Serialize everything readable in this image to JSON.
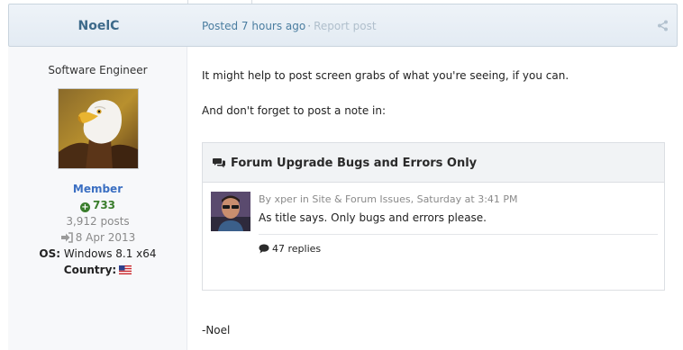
{
  "post": {
    "author": "NoelC",
    "posted": "Posted 7 hours ago",
    "separator": "·",
    "report": "Report post"
  },
  "author_panel": {
    "title": "Software Engineer",
    "group": "Member",
    "reputation": "733",
    "posts": "3,912 posts",
    "joined": "8 Apr 2013",
    "os_label": "OS:",
    "os_value": "Windows 8.1 x64",
    "country_label": "Country:"
  },
  "body": {
    "para1": "It might help to post screen grabs of what you're seeing, if you can.",
    "para2": "And don't forget to post a note in:",
    "signature": "-Noel"
  },
  "embed": {
    "title": "Forum Upgrade Bugs and Errors Only",
    "meta": "By xper in Site & Forum Issues, Saturday at 3:41 PM",
    "text": "As title says. Only bugs and errors please.",
    "replies": "47 replies"
  },
  "icons": {
    "share": "share-icon",
    "reputation": "plus-circle-icon",
    "joined": "sign-in-icon",
    "flag": "us-flag-icon",
    "embed": "comments-icon",
    "replies": "comment-icon"
  },
  "colors": {
    "author": "#3d6a8a",
    "meta_link": "#4a7da0",
    "group": "#3b6fc2",
    "reputation": "#3a7d2c"
  }
}
